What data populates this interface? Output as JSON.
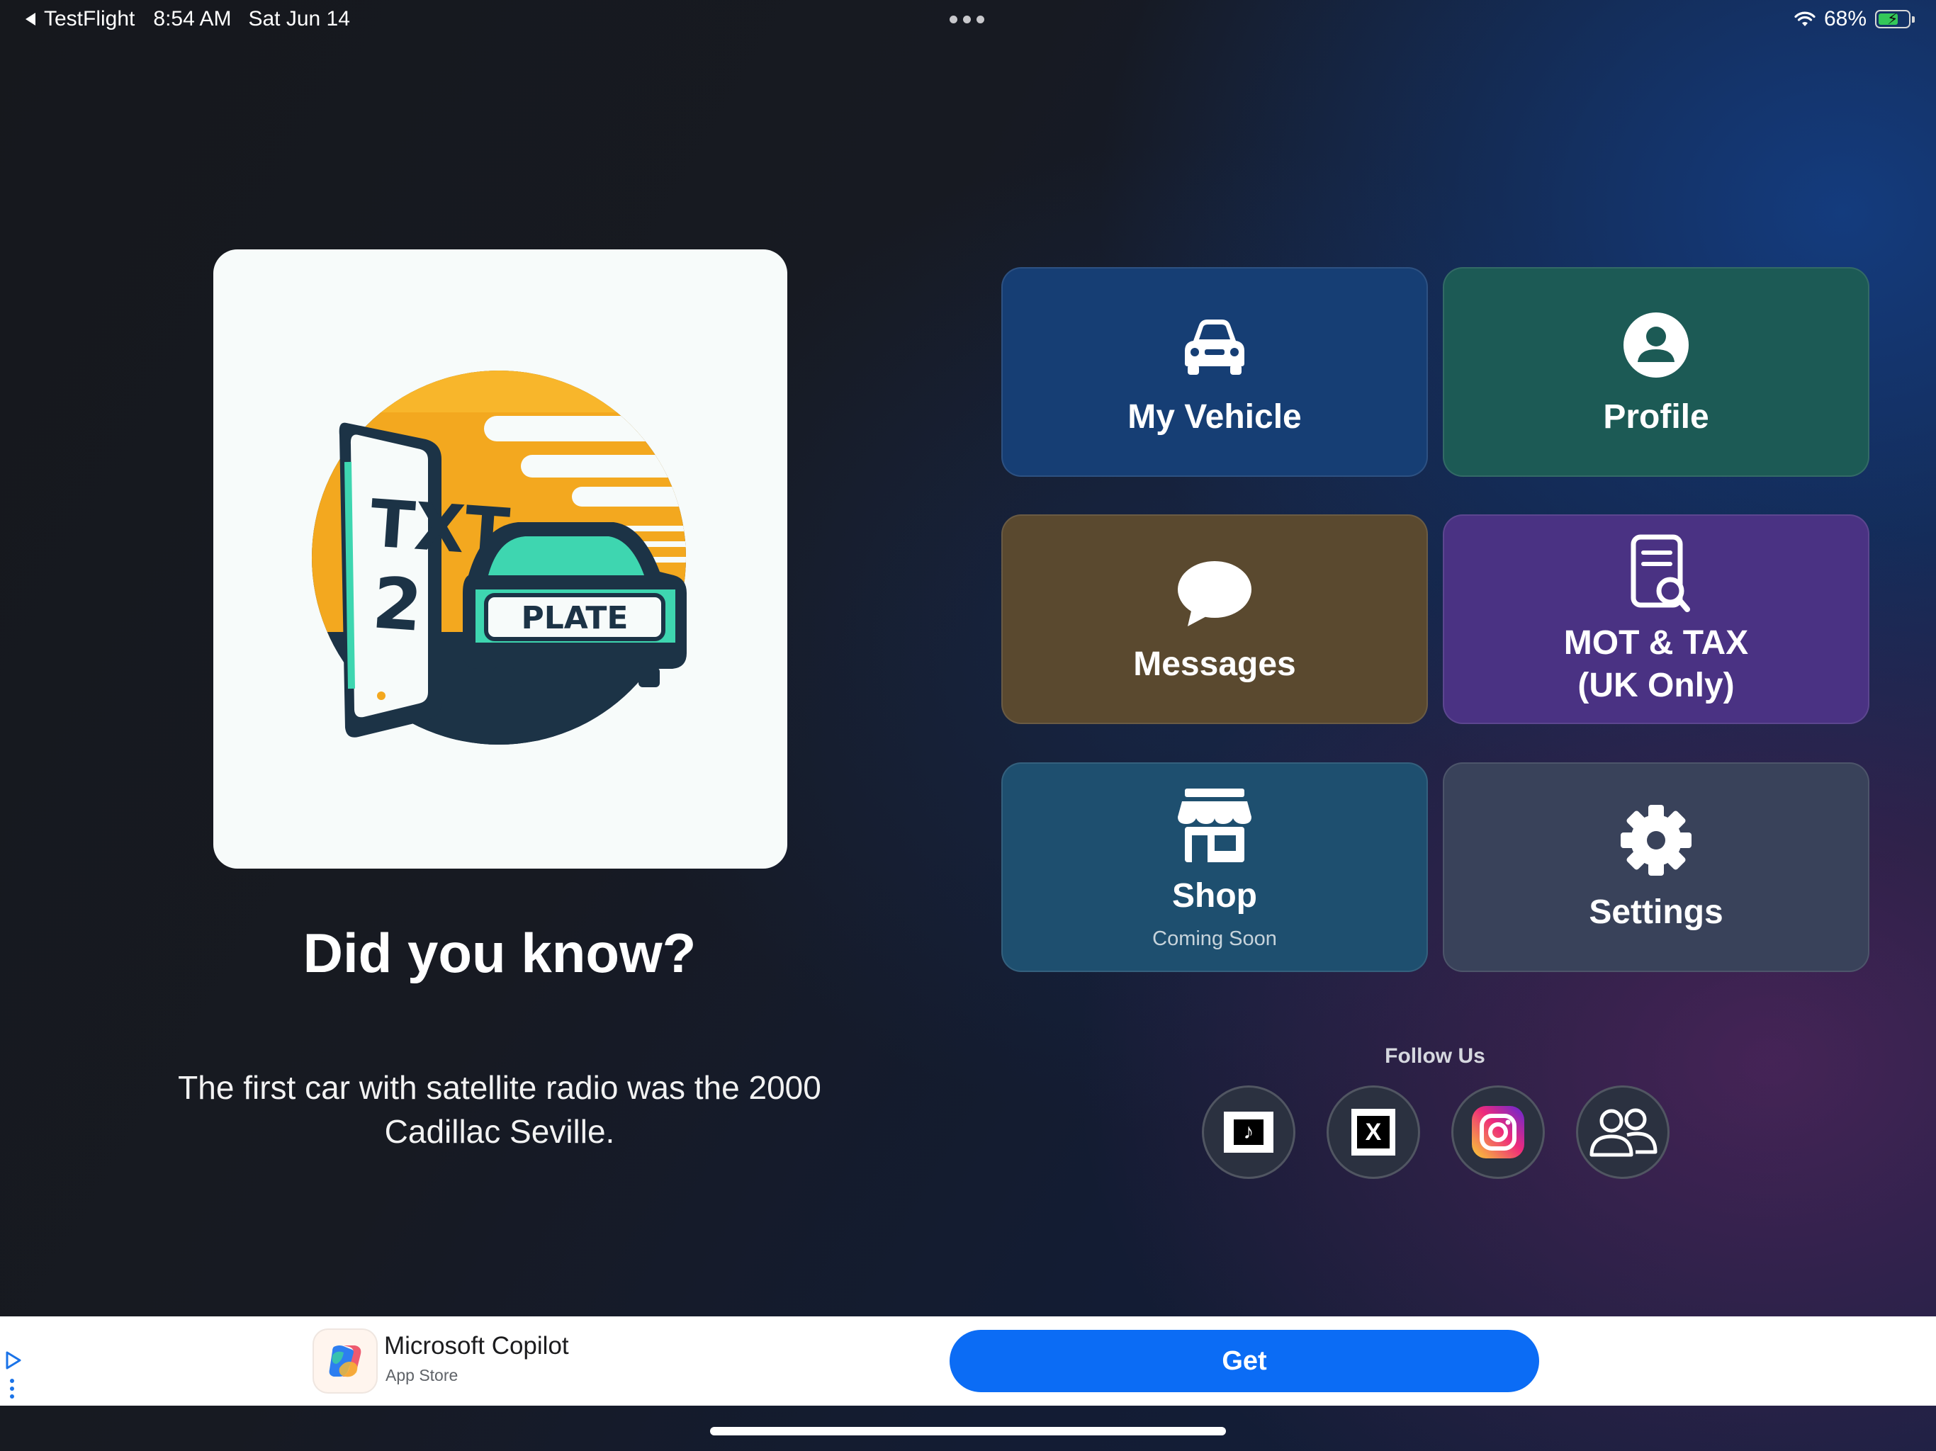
{
  "status_bar": {
    "back_app": "TestFlight",
    "time": "8:54 AM",
    "date": "Sat Jun 14",
    "battery_percent": "68%",
    "battery_level": 0.68,
    "charging": true
  },
  "logo": {
    "alt": "Txt2Plate logo",
    "line1": "TXT",
    "line2": "2",
    "plate_text": "PLATE"
  },
  "fact": {
    "heading": "Did you know?",
    "text": "The first car with satellite radio was the 2000 Cadillac Seville."
  },
  "tiles": {
    "vehicle": {
      "label": "My Vehicle",
      "icon": "car-icon",
      "color": "#163e74"
    },
    "profile": {
      "label": "Profile",
      "icon": "person-circle-icon",
      "color": "#1c5a55"
    },
    "messages": {
      "label": "Messages",
      "icon": "chat-bubble-icon",
      "color": "#5a492f"
    },
    "mot": {
      "label_line1": "MOT & TAX",
      "label_line2": "(UK Only)",
      "icon": "document-search-icon",
      "color": "#4a3283"
    },
    "shop": {
      "label": "Shop",
      "sublabel": "Coming Soon",
      "icon": "storefront-icon",
      "color": "#1e4f6f"
    },
    "settings": {
      "label": "Settings",
      "icon": "gear-icon",
      "color": "#39425a"
    }
  },
  "follow": {
    "label": "Follow Us",
    "links": [
      {
        "name": "TikTok",
        "icon": "tiktok-icon"
      },
      {
        "name": "X",
        "icon": "x-icon"
      },
      {
        "name": "Instagram",
        "icon": "instagram-icon"
      },
      {
        "name": "Community",
        "icon": "community-icon"
      }
    ]
  },
  "ad": {
    "app_name": "Microsoft Copilot",
    "store": "App Store",
    "cta": "Get",
    "cta_color": "#0b6cf5"
  }
}
